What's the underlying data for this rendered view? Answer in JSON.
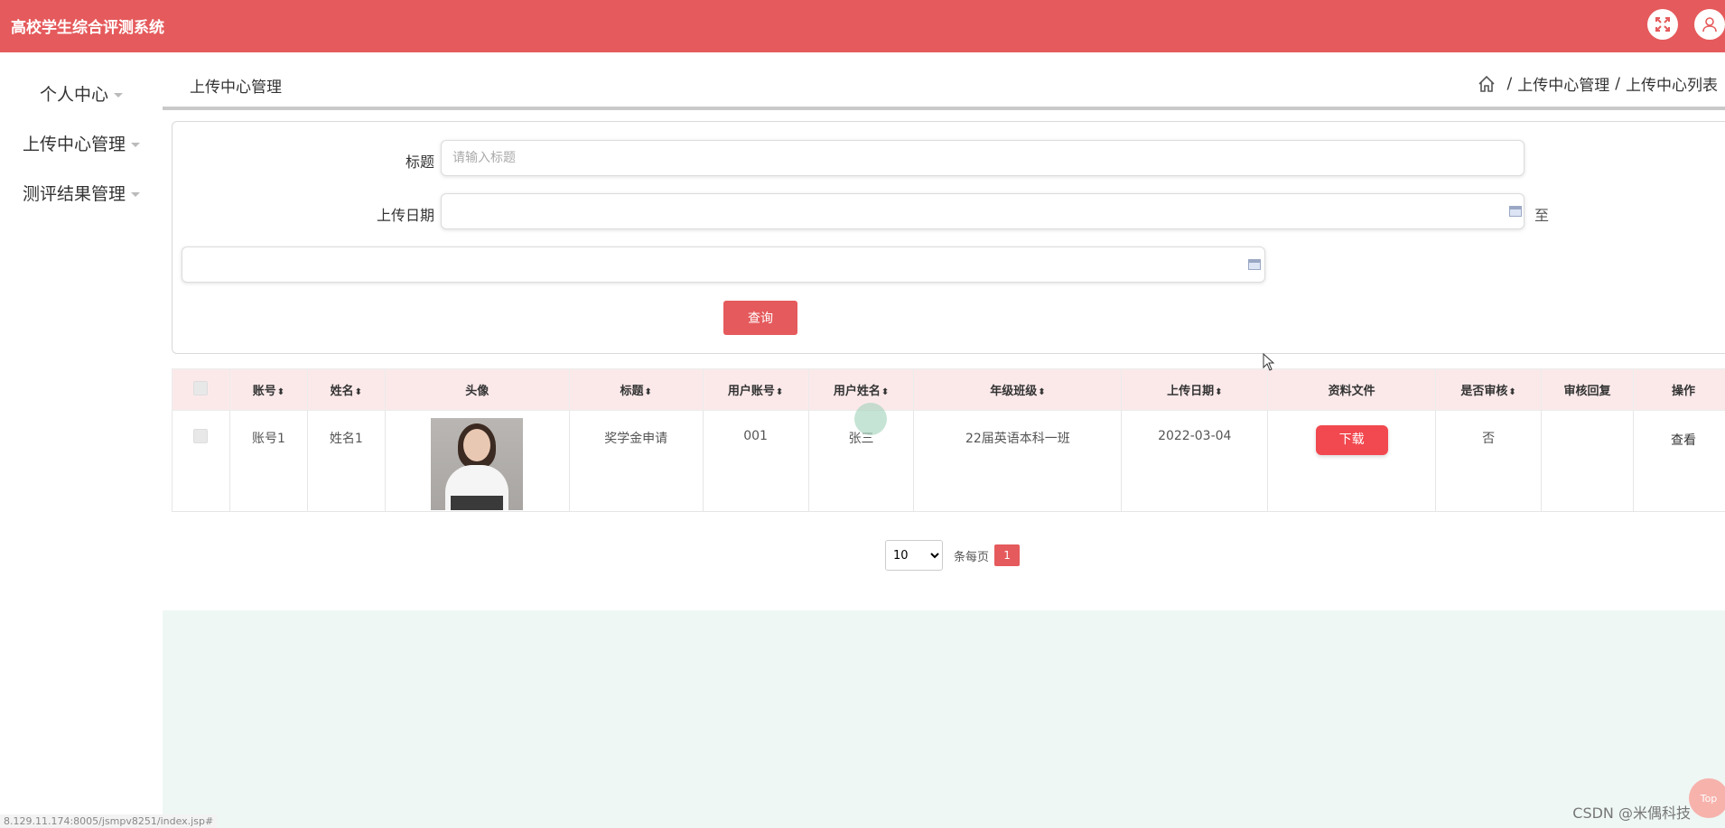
{
  "header": {
    "app_title": "高校学生综合评测系统",
    "icons": [
      "fullscreen-icon",
      "user-icon"
    ]
  },
  "sidebar": {
    "items": [
      {
        "label": "个人中心"
      },
      {
        "label": "上传中心管理"
      },
      {
        "label": "测评结果管理"
      }
    ]
  },
  "page": {
    "title": "上传中心管理",
    "breadcrumb": [
      "上传中心管理",
      "上传中心列表"
    ]
  },
  "search": {
    "title_label": "标题",
    "title_placeholder": "请输入标题",
    "title_value": "",
    "date_label": "上传日期",
    "date_start_value": "",
    "date_to_label": "至",
    "date_end_value": "",
    "query_button": "查询"
  },
  "table": {
    "headers": [
      {
        "label": "",
        "type": "checkbox"
      },
      {
        "label": "账号",
        "sortable": true
      },
      {
        "label": "姓名",
        "sortable": true
      },
      {
        "label": "头像",
        "sortable": false
      },
      {
        "label": "标题",
        "sortable": true
      },
      {
        "label": "用户账号",
        "sortable": true
      },
      {
        "label": "用户姓名",
        "sortable": true
      },
      {
        "label": "年级班级",
        "sortable": true
      },
      {
        "label": "上传日期",
        "sortable": true
      },
      {
        "label": "资料文件",
        "sortable": false
      },
      {
        "label": "是否审核",
        "sortable": true
      },
      {
        "label": "审核回复",
        "sortable": false
      },
      {
        "label": "操作",
        "sortable": false
      }
    ],
    "rows": [
      {
        "account": "账号1",
        "name": "姓名1",
        "title": "奖学金申请",
        "user_account": "001",
        "user_name": "张三",
        "grade_class": "22届英语本科一班",
        "upload_date": "2022-03-04",
        "file_button": "下载",
        "reviewed": "否",
        "review_reply": "",
        "action": "查看"
      }
    ]
  },
  "pagination": {
    "page_size": "10",
    "page_size_options": [
      "10"
    ],
    "per_page_label": "条每页",
    "current_page": "1"
  },
  "footer": {
    "watermark": "CSDN @米偶科技",
    "top_button": "Top",
    "status_url": "8.129.11.174:8005/jsmpv8251/index.jsp#"
  },
  "colors": {
    "primary": "#e55a5c",
    "download": "#f2484f",
    "table_header_bg": "#fbe9ea",
    "content_bg": "#eef7f4"
  }
}
